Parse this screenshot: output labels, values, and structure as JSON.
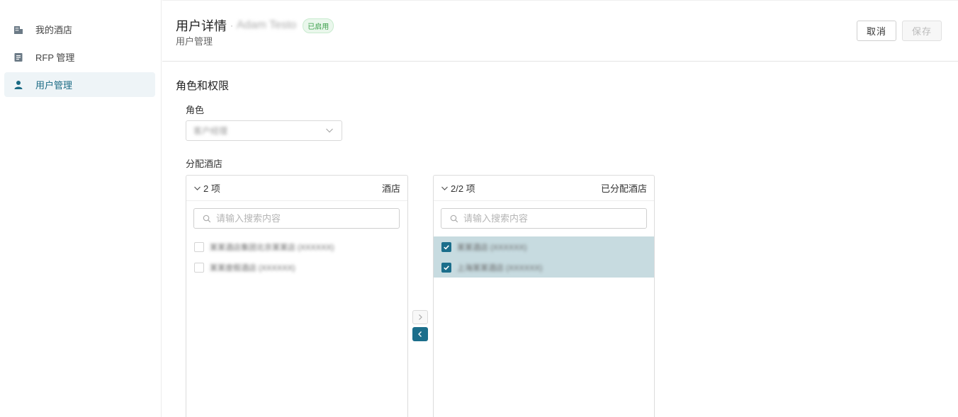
{
  "sidebar": {
    "items": [
      {
        "label": "我的酒店",
        "icon": "building-icon"
      },
      {
        "label": "RFP 管理",
        "icon": "document-icon"
      },
      {
        "label": "用户管理",
        "icon": "user-icon",
        "active": true
      }
    ]
  },
  "header": {
    "title": "用户详情",
    "separator": "·",
    "user_name": "Adam Testo",
    "status_badge": "已启用",
    "subtitle": "用户管理",
    "cancel_label": "取消",
    "save_label": "保存"
  },
  "roles": {
    "section_title": "角色和权限",
    "role_label": "角色",
    "role_value": "客户经理",
    "assign_label": "分配酒店"
  },
  "source_panel": {
    "count": "2 项",
    "title": "酒店",
    "search_placeholder": "请输入搜索内容",
    "items": [
      {
        "label": "某某酒店集团北京某某店 (XXXXXX)",
        "checked": false
      },
      {
        "label": "某某度假酒店 (XXXXXX)",
        "checked": false
      }
    ]
  },
  "target_panel": {
    "count": "2/2 项",
    "title": "已分配酒店",
    "search_placeholder": "请输入搜索内容",
    "items": [
      {
        "label": "某某酒店 (XXXXXX)",
        "checked": true
      },
      {
        "label": "上海某某酒店 (XXXXXX)",
        "checked": true
      }
    ]
  },
  "transfer": {
    "right_icon": "chevron-right-icon",
    "left_icon": "chevron-left-icon"
  },
  "colors": {
    "accent": "#1b6e8b",
    "selected_row": "#c7dbe0",
    "badge_green": "#3b9f4a"
  }
}
